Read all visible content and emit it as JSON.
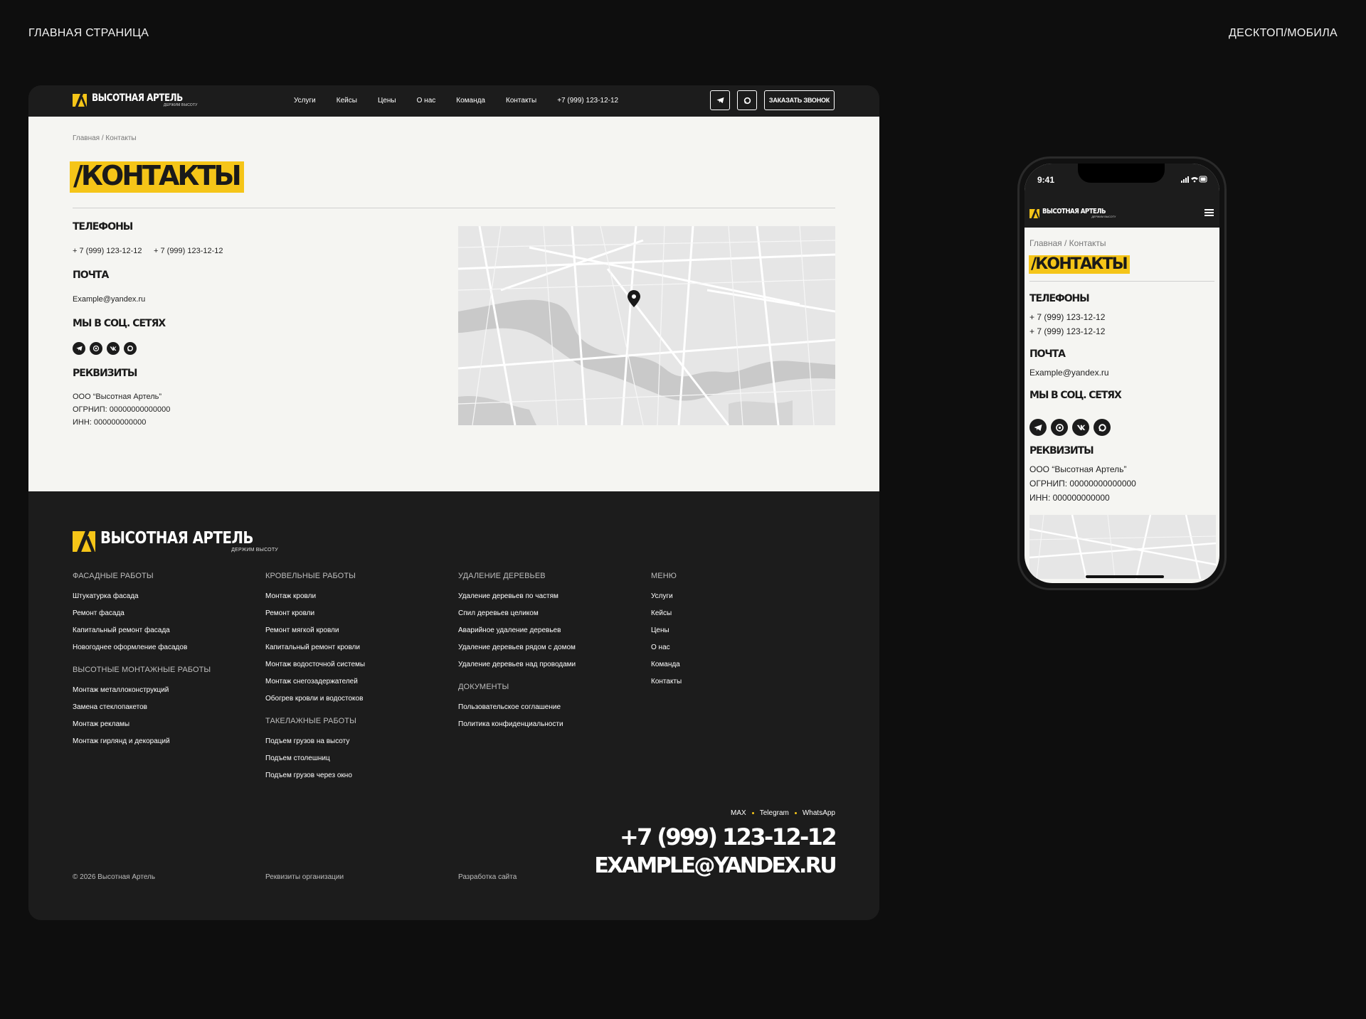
{
  "captions": {
    "left": "ГЛАВНАЯ СТРАНИЦА",
    "right": "ДЕСКТОП/МОБИЛА"
  },
  "brand": {
    "name": "ВЫСОТНАЯ АРТЕЛЬ",
    "tagline": "ДЕРЖИМ ВЫСОТУ",
    "accent": "#f5c518",
    "dark": "#1c1c1c"
  },
  "nav": {
    "items": [
      "Услуги",
      "Кейсы",
      "Цены",
      "О нас",
      "Команда",
      "Контакты",
      "+7 (999) 123-12-12"
    ],
    "telegram_icon": "telegram-icon",
    "max_icon": "max-messenger-icon",
    "cta": "ЗАКАЗАТЬ ЗВОНОК"
  },
  "contacts": {
    "breadcrumb": "Главная / Контакты",
    "title": "/КОНТАКТЫ",
    "phones_title": "ТЕЛЕФОНЫ",
    "phones": [
      "+ 7 (999) 123-12-12",
      "+ 7 (999) 123-12-12"
    ],
    "mail_title": "ПОЧТА",
    "email": "Example@yandex.ru",
    "social_title": "МЫ В СОЦ. СЕТЯХ",
    "socials": [
      "telegram-icon",
      "whatsapp-icon",
      "vk-icon",
      "max-messenger-icon"
    ],
    "requisites_title": "РЕКВИЗИТЫ",
    "org": "ООО “Высотная Артель”",
    "ogrn": "ОГРНИП: 00000000000000",
    "inn": "ИНН: 000000000000",
    "map_icon": "map-pin-icon"
  },
  "footer": {
    "col1": {
      "head1": "ФАСАДНЫЕ РАБОТЫ",
      "links1": [
        "Штукатурка фасада",
        "Ремонт фасада",
        "Капитальный ремонт фасада",
        "Новогоднее оформление фасадов"
      ],
      "head2": "ВЫСОТНЫЕ МОНТАЖНЫЕ РАБОТЫ",
      "links2": [
        "Монтаж металлоконструкций",
        "Замена стеклопакетов",
        "Монтаж рекламы",
        "Монтаж гирлянд и декораций"
      ]
    },
    "col2": {
      "head1": "КРОВЕЛЬНЫЕ РАБОТЫ",
      "links1": [
        "Монтаж кровли",
        "Ремонт кровли",
        "Ремонт мягкой кровли",
        "Капитальный ремонт кровли",
        "Монтаж водосточной системы",
        "Монтаж снегозадержателей",
        "Обогрев кровли и водостоков"
      ],
      "head2": "ТАКЕЛАЖНЫЕ РАБОТЫ",
      "links2": [
        "Подъем грузов на высоту",
        "Подъем столешниц",
        "Подъем грузов через окно"
      ]
    },
    "col3": {
      "head1": "УДАЛЕНИЕ ДЕРЕВЬЕВ",
      "links1": [
        "Удаление деревьев по частям",
        "Спил деревьев целиком",
        "Аварийное удаление деревьев",
        "Удаление деревьев рядом с домом",
        "Удаление деревьев над проводами"
      ],
      "head2": "ДОКУМЕНТЫ",
      "links2": [
        "Пользовательское соглашение",
        "Политика конфиденциальности"
      ]
    },
    "col4": {
      "head1": "МЕНЮ",
      "links1": [
        "Услуги",
        "Кейсы",
        "Цены",
        "О нас",
        "Команда",
        "Контакты"
      ]
    },
    "messengers": [
      "MAX",
      "Telegram",
      "WhatsApp"
    ],
    "phone": "+7 (999) 123-12-12",
    "email": "EXAMPLE@YANDEX.RU",
    "copyright": "© 2026 Высотная Артель",
    "requisites_link": "Реквизиты организации",
    "dev_link": "Разработка сайта"
  },
  "mobile": {
    "time": "9:41",
    "breadcrumb": "Главная / Контакты",
    "title": "/КОНТАКТЫ",
    "phones_title": "ТЕЛЕФОНЫ",
    "phone1": "+ 7 (999) 123-12-12",
    "phone2": "+ 7 (999) 123-12-12",
    "mail_title": "ПОЧТА",
    "email": "Example@yandex.ru",
    "social_title": "МЫ В СОЦ. СЕТЯХ",
    "requisites_title": "РЕКВИЗИТЫ",
    "org": "ООО “Высотная Артель”",
    "ogrn": "ОГРНИП: 00000000000000",
    "inn": "ИНН: 000000000000"
  }
}
